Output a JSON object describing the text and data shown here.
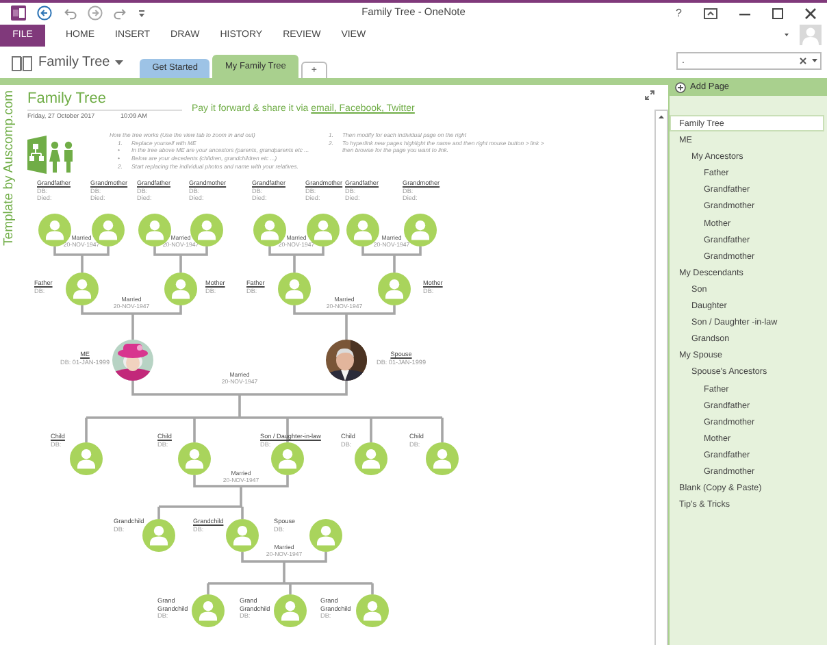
{
  "window": {
    "title": "Family Tree - OneNote",
    "help": "?"
  },
  "ribbon_tabs": [
    {
      "label": "FILE",
      "kind": "file"
    },
    {
      "label": "HOME",
      "kind": "tab"
    },
    {
      "label": "INSERT",
      "kind": "tab"
    },
    {
      "label": "DRAW",
      "kind": "tab"
    },
    {
      "label": "HISTORY",
      "kind": "tab"
    },
    {
      "label": "REVIEW",
      "kind": "tab"
    },
    {
      "label": "VIEW",
      "kind": "tab"
    }
  ],
  "notebook": {
    "name": "Family Tree"
  },
  "section_tabs": [
    {
      "label": "Get Started",
      "selected": false,
      "color": "#9dc3e6"
    },
    {
      "label": "My Family Tree",
      "selected": true,
      "color": "#a9d08e"
    }
  ],
  "add_section": "+",
  "search": {
    "value": "."
  },
  "page": {
    "side_text": "Template by Auscomp.com",
    "title": "Family Tree",
    "date": "Friday, 27 October 2017",
    "time": "10:09 AM",
    "share_text": "Pay it forward & share it via",
    "share_link": "email, Facebook, Twitter"
  },
  "instructions_left": [
    {
      "kind": "heading",
      "text": "How the tree works (Use the view tab to zoom in and out)"
    },
    {
      "kind": "step",
      "marker": "1.",
      "text": "Replace yourself with ME"
    },
    {
      "kind": "step",
      "marker": "•",
      "text": "In the tree above ME are your ancestors (parents, grandparents etc ..."
    },
    {
      "kind": "step",
      "marker": "•",
      "text": "Below are your decedents (children, grandchildren etc ...)"
    },
    {
      "kind": "step",
      "marker": "2.",
      "text": "Start replacing the individual photos and name with your relatives."
    }
  ],
  "instructions_right": [
    {
      "kind": "step",
      "marker": "1.",
      "text": "Then modify for each individual page on the right"
    },
    {
      "kind": "step",
      "marker": "2.",
      "text": "To hyperlink new pages highlight the name and then right mouse button > link >"
    },
    {
      "kind": "continuation",
      "text": "then browse for the page you want to link."
    }
  ],
  "people": [
    {
      "name": "Grandfather",
      "linked": true,
      "birth": "DB:",
      "death": "Died:",
      "kind": "avatar"
    },
    {
      "name": "Grandmother",
      "linked": true,
      "birth": "DB:",
      "death": "Died:",
      "kind": "avatar"
    },
    {
      "name": "Grandfather",
      "linked": true,
      "birth": "DB:",
      "death": "Died:",
      "kind": "avatar"
    },
    {
      "name": "Grandmother",
      "linked": true,
      "birth": "DB:",
      "death": "Died:",
      "kind": "avatar"
    },
    {
      "name": "Grandfather",
      "linked": true,
      "birth": "DB:",
      "death": "Died:",
      "kind": "avatar"
    },
    {
      "name": "Grandmother",
      "linked": true,
      "birth": "DB:",
      "death": "Died:",
      "kind": "avatar"
    },
    {
      "name": "Grandfather",
      "linked": true,
      "birth": "DB:",
      "death": "Died:",
      "kind": "avatar"
    },
    {
      "name": "Grandmother",
      "linked": true,
      "birth": "DB:",
      "death": "Died:",
      "kind": "avatar"
    },
    {
      "name": "Father",
      "linked": true,
      "birth": "DB:",
      "kind": "avatar"
    },
    {
      "name": "Mother",
      "linked": true,
      "birth": "DB:",
      "kind": "avatar"
    },
    {
      "name": "Father",
      "linked": true,
      "birth": "DB:",
      "kind": "avatar"
    },
    {
      "name": "Mother",
      "linked": true,
      "birth": "DB:",
      "kind": "avatar"
    },
    {
      "name": "ME",
      "linked": true,
      "birth": "DB: 01-JAN-1999",
      "kind": "picture"
    },
    {
      "name": "Spouse",
      "linked": true,
      "birth": "DB: 01-JAN-1999",
      "kind": "picture"
    },
    {
      "name": "Child",
      "linked": true,
      "birth": "DB:",
      "kind": "avatar"
    },
    {
      "name": "Child",
      "linked": true,
      "birth": "DB:",
      "kind": "avatar"
    },
    {
      "name": "Son / Daughter-in-law",
      "linked": true,
      "birth": "DB:",
      "kind": "avatar"
    },
    {
      "name": "Child",
      "linked": false,
      "birth": "DB:",
      "kind": "avatar"
    },
    {
      "name": "Child",
      "linked": false,
      "birth": "DB:",
      "kind": "avatar"
    },
    {
      "name": "Grandchild",
      "linked": false,
      "birth": "DB:",
      "kind": "avatar"
    },
    {
      "name": "Grandchild",
      "linked": true,
      "birth": "DB:",
      "kind": "avatar"
    },
    {
      "name": "Spouse",
      "linked": false,
      "birth": "DB:",
      "kind": "avatar"
    },
    {
      "name": "Grand Grandchild",
      "linked": false,
      "birth": "DB:",
      "kind": "avatar"
    },
    {
      "name": "Grand Grandchild",
      "linked": false,
      "birth": "DB:",
      "kind": "avatar"
    },
    {
      "name": "Grand Grandchild",
      "linked": false,
      "birth": "DB:",
      "kind": "avatar"
    }
  ],
  "marriages": [
    {
      "label": "Married",
      "date": "20-NOV-1947"
    },
    {
      "label": "Married",
      "date": "20-NOV-1947"
    },
    {
      "label": "Married",
      "date": "20-NOV-1947"
    },
    {
      "label": "Married",
      "date": "20-NOV-1947"
    },
    {
      "label": "Married",
      "date": "20-NOV-1947"
    },
    {
      "label": "Married",
      "date": "20-NOV-1947"
    },
    {
      "label": "Married",
      "date": "20-NOV-1947"
    },
    {
      "label": "Married",
      "date": "20-NOV-1947"
    },
    {
      "label": "Married",
      "date": "20-NOV-1947"
    }
  ],
  "add_page": "Add Page",
  "pages": [
    {
      "title": "Family Tree",
      "selected": true
    },
    {
      "title": "ME",
      "selected": false,
      "children": [
        {
          "title": "My Ancestors",
          "selected": false,
          "children": [
            {
              "title": "Father",
              "selected": false
            },
            {
              "title": "Grandfather",
              "selected": false
            },
            {
              "title": "Grandmother",
              "selected": false
            },
            {
              "title": "Mother",
              "selected": false
            },
            {
              "title": "Grandfather",
              "selected": false
            },
            {
              "title": "Grandmother",
              "selected": false
            }
          ]
        }
      ]
    },
    {
      "title": "My Descendants",
      "selected": false,
      "children": [
        {
          "title": "Son",
          "selected": false
        },
        {
          "title": "Daughter",
          "selected": false
        },
        {
          "title": "Son / Daughter -in-law",
          "selected": false
        },
        {
          "title": "Grandson",
          "selected": false
        }
      ]
    },
    {
      "title": "My Spouse",
      "selected": false,
      "children": [
        {
          "title": "Spouse's Ancestors",
          "selected": false,
          "children": [
            {
              "title": "Father",
              "selected": false
            },
            {
              "title": "Grandfather",
              "selected": false
            },
            {
              "title": "Grandmother",
              "selected": false
            },
            {
              "title": "Mother",
              "selected": false
            },
            {
              "title": "Grandfather",
              "selected": false
            },
            {
              "title": "Grandmother",
              "selected": false
            }
          ]
        }
      ]
    },
    {
      "title": "Blank (Copy & Paste)",
      "selected": false
    },
    {
      "title": "Tip's & Tricks",
      "selected": false
    }
  ]
}
